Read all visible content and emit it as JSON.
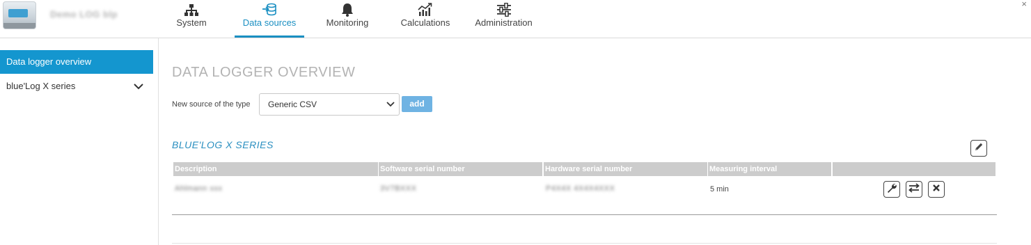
{
  "header": {
    "device_name": "Demo LOG blp",
    "close_glyph": "×",
    "tabs": [
      {
        "label": "System",
        "icon": "sitemap-icon",
        "active": false
      },
      {
        "label": "Data sources",
        "icon": "database-arrow-icon",
        "active": true
      },
      {
        "label": "Monitoring",
        "icon": "bell-icon",
        "active": false
      },
      {
        "label": "Calculations",
        "icon": "chart-icon",
        "active": false
      },
      {
        "label": "Administration",
        "icon": "sliders-icon",
        "active": false
      }
    ]
  },
  "sidebar": {
    "items": [
      {
        "label": "Data logger overview",
        "active": true
      },
      {
        "label": "blue'Log X series",
        "active": false,
        "expandable": true
      }
    ]
  },
  "main": {
    "title": "DATA LOGGER OVERVIEW",
    "new_source_label": "New source of the type",
    "source_type_selected": "Generic CSV",
    "add_label": "add",
    "section": {
      "title": "BLUE'LOG X SERIES",
      "columns": [
        "Description",
        "Software serial number",
        "Hardware serial number",
        "Measuring interval",
        ""
      ],
      "rows": [
        {
          "description": "Ahlmann xxx",
          "software_serial": "3V7BXXX",
          "hardware_serial": "P4X4X 4X4X4XXX",
          "measuring_interval": "5 min",
          "actions": [
            "wrench-icon",
            "swap-arrows-icon",
            "delete-x-icon"
          ]
        }
      ]
    }
  },
  "colors": {
    "accent": "#1496cf",
    "add_button": "#6fb3e3",
    "table_header": "#cccccc",
    "section_title": "#2a8fc0"
  }
}
